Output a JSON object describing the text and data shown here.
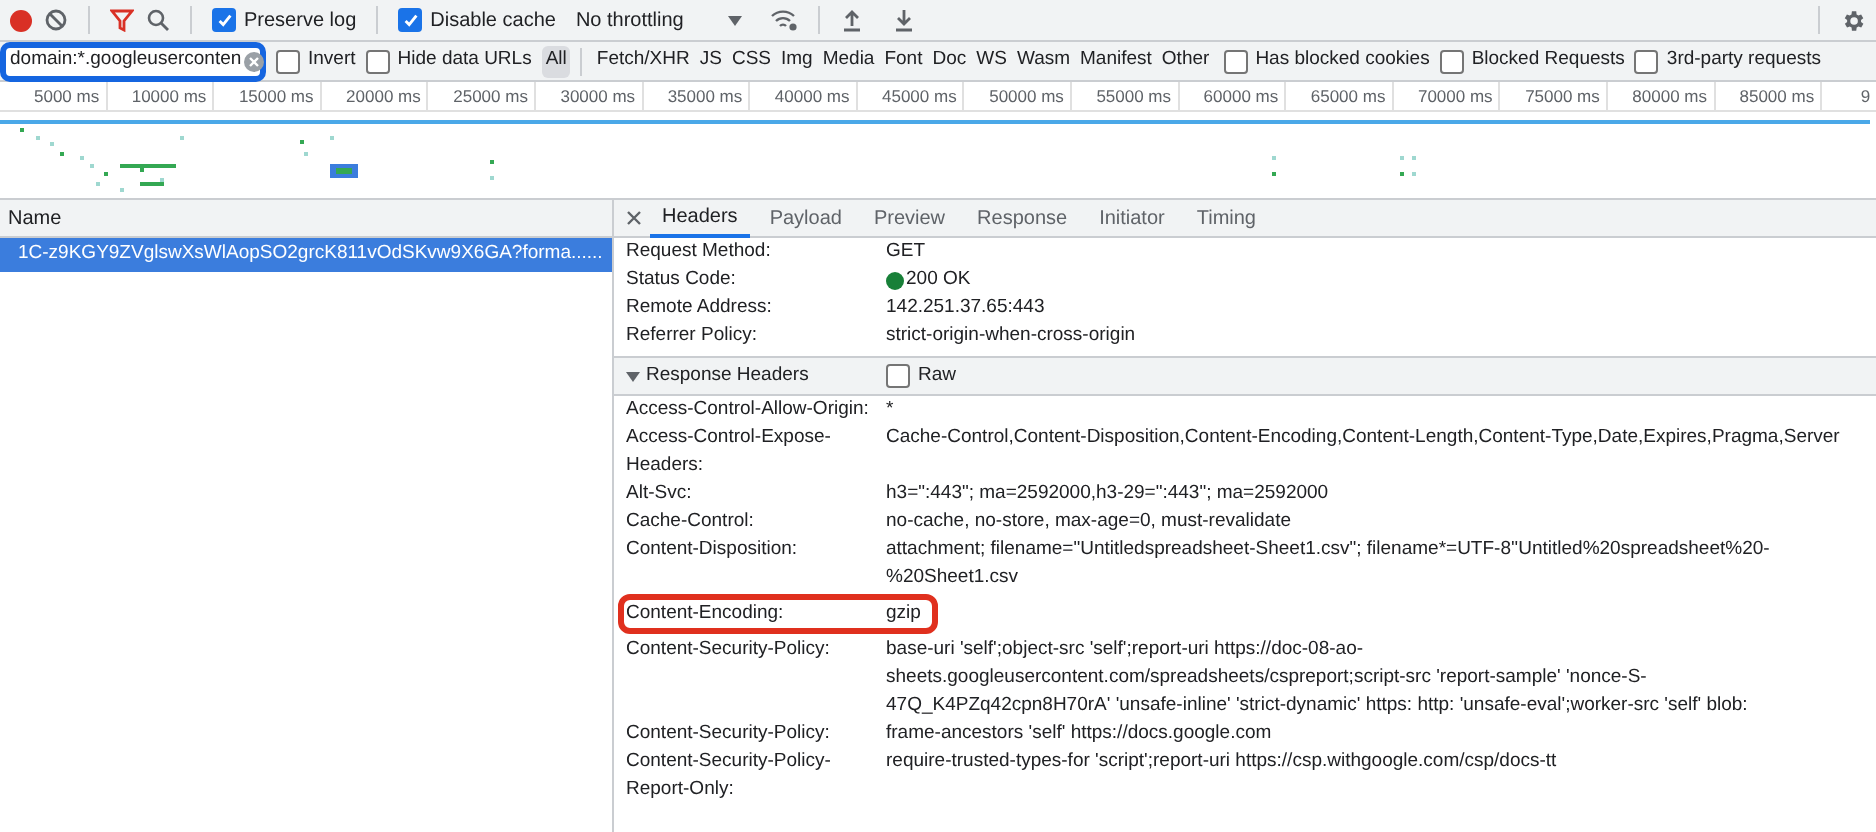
{
  "toolbar": {
    "recording": true,
    "preserve_log": {
      "label": "Preserve log",
      "checked": true
    },
    "disable_cache": {
      "label": "Disable cache",
      "checked": true
    },
    "throttling": "No throttling"
  },
  "filter_bar": {
    "filter": {
      "value": "domain:*.googleuserconten",
      "highlighted": true
    },
    "invert": {
      "label": "Invert",
      "checked": false
    },
    "hide_data_urls": {
      "label": "Hide data URLs",
      "checked": false
    },
    "types": [
      {
        "label": "All",
        "selected": true
      },
      {
        "label": "Fetch/XHR",
        "selected": false
      },
      {
        "label": "JS",
        "selected": false
      },
      {
        "label": "CSS",
        "selected": false
      },
      {
        "label": "Img",
        "selected": false
      },
      {
        "label": "Media",
        "selected": false
      },
      {
        "label": "Font",
        "selected": false
      },
      {
        "label": "Doc",
        "selected": false
      },
      {
        "label": "WS",
        "selected": false
      },
      {
        "label": "Wasm",
        "selected": false
      },
      {
        "label": "Manifest",
        "selected": false
      },
      {
        "label": "Other",
        "selected": false
      }
    ],
    "options": [
      {
        "label": "Has blocked cookies",
        "checked": false
      },
      {
        "label": "Blocked Requests",
        "checked": false
      },
      {
        "label": "3rd-party requests",
        "checked": false
      }
    ]
  },
  "timeline": {
    "ticks": [
      "5000 ms",
      "10000 ms",
      "15000 ms",
      "20000 ms",
      "25000 ms",
      "30000 ms",
      "35000 ms",
      "40000 ms",
      "45000 ms",
      "50000 ms",
      "55000 ms",
      "60000 ms",
      "65000 ms",
      "70000 ms",
      "75000 ms",
      "80000 ms",
      "85000 ms",
      "9"
    ]
  },
  "requests": {
    "column": "Name",
    "rows": [
      {
        "name": "1C-z9KGY9ZVglswXsWlAopSO2grcK811vOdSKvw9X6GA?forma......",
        "selected": true
      }
    ]
  },
  "details": {
    "tabs": [
      {
        "label": "Headers",
        "selected": true
      },
      {
        "label": "Payload",
        "selected": false
      },
      {
        "label": "Preview",
        "selected": false
      },
      {
        "label": "Response",
        "selected": false
      },
      {
        "label": "Initiator",
        "selected": false
      },
      {
        "label": "Timing",
        "selected": false
      }
    ],
    "general": [
      {
        "kind": "plain",
        "name": "Request Method:",
        "value": "GET"
      },
      {
        "kind": "status",
        "name": "Status Code:",
        "value": "200 OK"
      },
      {
        "kind": "plain",
        "name": "Remote Address:",
        "value": "142.251.37.65:443"
      },
      {
        "kind": "plain",
        "name": "Referrer Policy:",
        "value": "strict-origin-when-cross-origin"
      }
    ],
    "response_headers": {
      "title": "Response Headers",
      "expanded": true,
      "raw": {
        "label": "Raw",
        "checked": false
      },
      "rows": [
        {
          "name": "Access-Control-Allow-Origin:",
          "value": "*",
          "highlighted": false
        },
        {
          "name": "Access-Control-Expose-Headers:",
          "value": "Cache-Control,Content-Disposition,Content-Encoding,Content-Length,Content-Type,Date,Expires,Pragma,Server",
          "highlighted": false
        },
        {
          "name": "Alt-Svc:",
          "value": "h3=\":443\"; ma=2592000,h3-29=\":443\"; ma=2592000",
          "highlighted": false
        },
        {
          "name": "Cache-Control:",
          "value": "no-cache, no-store, max-age=0, must-revalidate",
          "highlighted": false
        },
        {
          "name": "Content-Disposition:",
          "value": "attachment; filename=\"Untitledspreadsheet-Sheet1.csv\"; filename*=UTF-8''Untitled%20spreadsheet%20-%20Sheet1.csv",
          "highlighted": false
        },
        {
          "name": "Content-Encoding:",
          "value": "gzip",
          "highlighted": true
        },
        {
          "name": "Content-Security-Policy:",
          "value": "base-uri 'self';object-src 'self';report-uri https://doc-08-ao-sheets.googleusercontent.com/spreadsheets/cspreport;script-src 'report-sample' 'nonce-S-47Q_K4PZq42cpn8H70rA' 'unsafe-inline' 'strict-dynamic' https: http: 'unsafe-eval';worker-src 'self' blob:",
          "highlighted": false
        },
        {
          "name": "Content-Security-Policy:",
          "value": "frame-ancestors 'self' https://docs.google.com",
          "highlighted": false
        },
        {
          "name": "Content-Security-Policy-Report-Only:",
          "value": "require-trusted-types-for 'script';report-uri https://csp.withgoogle.com/csp/docs-tt",
          "highlighted": false
        }
      ]
    }
  }
}
